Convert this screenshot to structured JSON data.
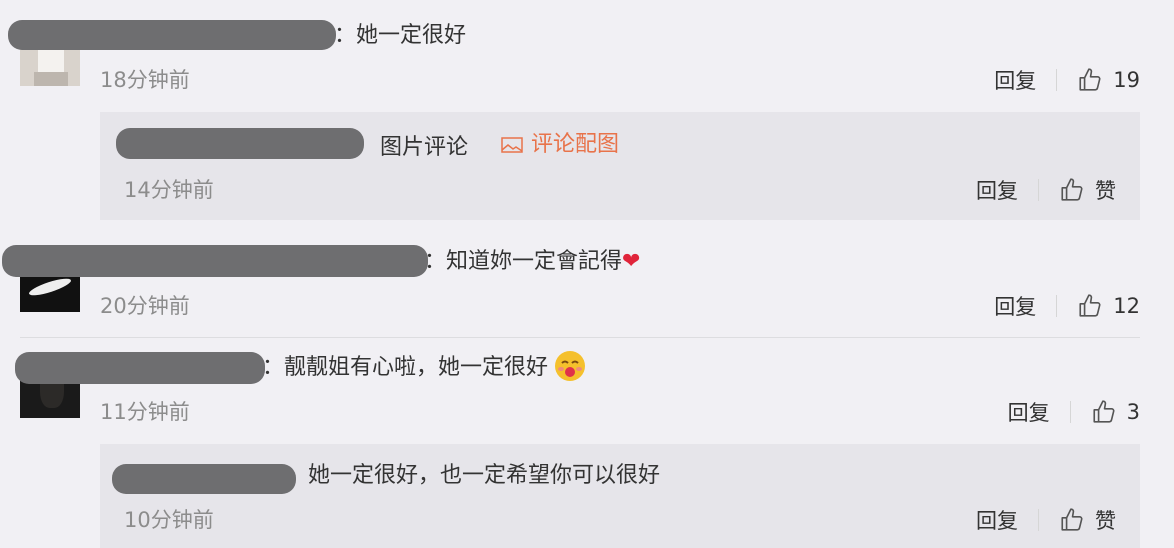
{
  "comments": [
    {
      "text": "：她一定很好",
      "time": "18分钟前",
      "reply_label": "回复",
      "like_count": "19",
      "replies": [
        {
          "label": "图片评论",
          "pic_link": "评论配图",
          "time": "14分钟前",
          "reply_label": "回复",
          "like_label": "赞"
        }
      ]
    },
    {
      "text": "：知道妳一定會記得",
      "emoji": "❤",
      "time": "20分钟前",
      "reply_label": "回复",
      "like_count": "12"
    },
    {
      "text": "：靓靓姐有心啦，她一定很好",
      "time": "11分钟前",
      "reply_label": "回复",
      "like_count": "3",
      "replies": [
        {
          "text": "她一定很好，也一定希望你可以很好",
          "time": "10分钟前",
          "reply_label": "回复",
          "like_label": "赞"
        }
      ]
    }
  ],
  "colors": {
    "background": "#f1f0f4",
    "subcomment_bg": "#e6e5ea",
    "link_orange": "#e8734a",
    "muted_text": "#8c8c8c"
  },
  "icons": [
    "thumbs-up-icon",
    "image-icon",
    "heart-emoji",
    "kiss-emoji"
  ]
}
